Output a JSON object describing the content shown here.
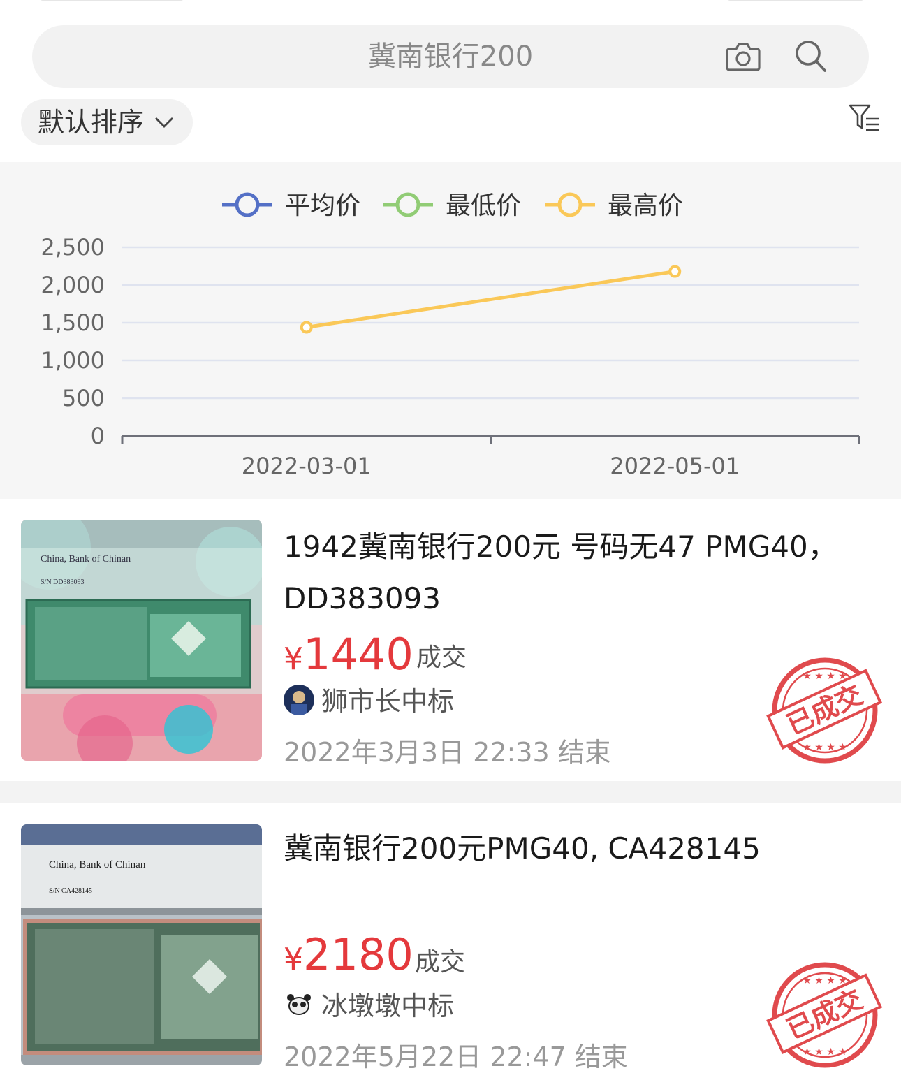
{
  "search": {
    "query": "冀南银行200"
  },
  "sort": {
    "label": "默认排序"
  },
  "chart_data": {
    "type": "line",
    "legend": [
      "平均价",
      "最低价",
      "最高价"
    ],
    "legend_position": "top",
    "colors": {
      "平均价": "#5470c6",
      "最低价": "#91cc75",
      "最高价": "#fac858"
    },
    "x": [
      "2022-03-01",
      "2022-05-01"
    ],
    "x_ticks": [
      "2022-03-01",
      "2022-05-01"
    ],
    "y_ticks": [
      "0",
      "500",
      "1,000",
      "1,500",
      "2,000",
      "2,500"
    ],
    "ylim": [
      0,
      2500
    ],
    "grid": true,
    "series": [
      {
        "name": "最高价",
        "points": [
          {
            "x": "2022-03-01",
            "y": 1440
          },
          {
            "x": "2022-05-01",
            "y": 2180
          }
        ]
      }
    ]
  },
  "listings": [
    {
      "title": "1942冀南银行200元 号码无47 PMG40，DD383093",
      "yen": "¥",
      "price": "1440",
      "deal": "成交",
      "winner": "狮市长中标",
      "end_time": "2022年3月3日 22:33 结束",
      "thumb": {
        "slab_text_1": "China, Bank of Chinan",
        "slab_text_2": "S/N DD383093",
        "note_color": "#3f8a6c"
      },
      "stamp": "已成交"
    },
    {
      "title": "冀南银行200元PMG40, CA428145",
      "yen": "¥",
      "price": "2180",
      "deal": "成交",
      "winner": "冰墩墩中标",
      "end_time": "2022年5月22日 22:47 结束",
      "thumb": {
        "slab_text_1": "China, Bank of Chinan",
        "slab_text_2": "S/N CA428145",
        "note_color": "#4f6e5c"
      },
      "stamp": "已成交"
    }
  ]
}
